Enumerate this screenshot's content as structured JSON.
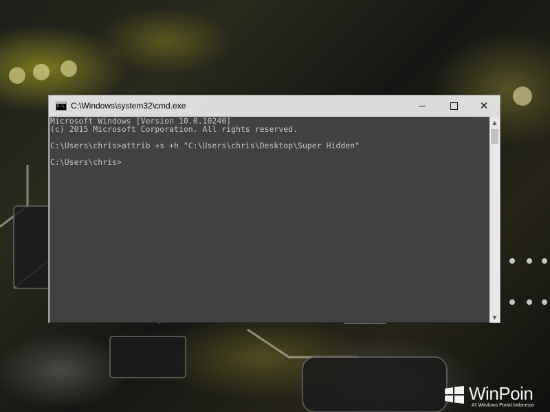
{
  "window": {
    "title": "C:\\Windows\\system32\\cmd.exe",
    "icon": "cmd-icon",
    "icon_text": "C:\\"
  },
  "console": {
    "lines": [
      "Microsoft Windows [Version 10.0.10240]",
      "(c) 2015 Microsoft Corporation. All rights reserved.",
      "",
      "C:\\Users\\chris>attrib +s +h \"C:\\Users\\chris\\Desktop\\Super Hidden\"",
      "",
      "C:\\Users\\chris>"
    ],
    "text_color": "#c6c6c6"
  },
  "watermark": {
    "brand": "WinPoin",
    "tagline": "#1 Windows Portal Indonesia"
  },
  "controls": {
    "minimize": "minimize-icon",
    "maximize": "maximize-icon",
    "close": "close-icon",
    "close_glyph": "✕",
    "scroll_up": "▲",
    "scroll_down": "▼"
  }
}
